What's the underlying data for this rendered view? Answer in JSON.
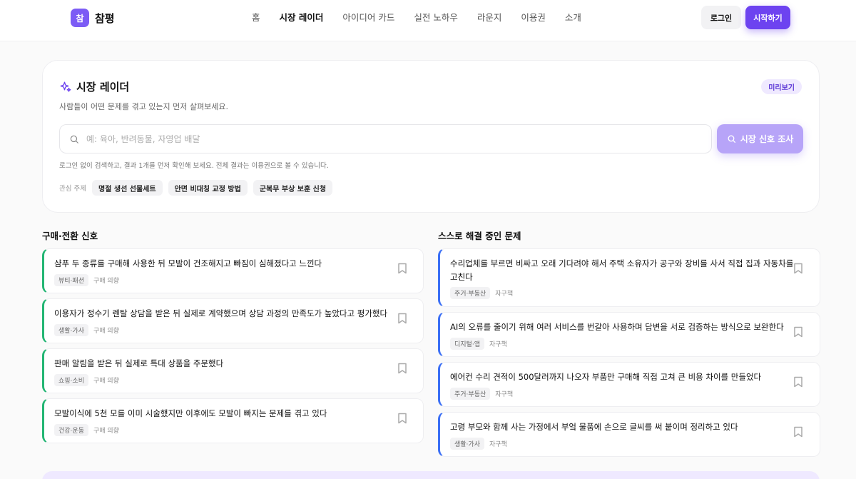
{
  "brand": {
    "mark": "참",
    "name": "참평"
  },
  "nav": [
    {
      "label": "홈"
    },
    {
      "label": "시장 레이더"
    },
    {
      "label": "아이디어 카드"
    },
    {
      "label": "실전 노하우"
    },
    {
      "label": "라운지"
    },
    {
      "label": "이용권"
    },
    {
      "label": "소개"
    }
  ],
  "auth": {
    "login": "로그인",
    "start": "시작하기"
  },
  "radar": {
    "title": "시장 레이더",
    "badge": "미리보기",
    "subtitle": "사람들이 어떤 문제를 겪고 있는지 먼저 살펴보세요.",
    "search_placeholder": "예: 육아, 반려동물, 자영업 배달",
    "search_value": "",
    "scan_button": "시장 신호 조사",
    "note": "로그인 없이 검색하고, 결과 1개를 먼저 확인해 보세요. 전체 결과는 이용권으로 볼 수 있습니다.",
    "topics_label": "관심 주제",
    "topics": [
      "명절 생선 선물세트",
      "안면 비대칭 교정 방법",
      "군복무 부상 보훈 신청"
    ]
  },
  "purchase": {
    "title": "구매·전환 신호",
    "items": [
      {
        "text": "샴푸 두 종류를 구매해 사용한 뒤 모발이 건조해지고 빠짐이 심해졌다고 느낀다",
        "category": "뷰티·패션",
        "signal": "구매 의향"
      },
      {
        "text": "이용자가 정수기 렌탈 상담을 받은 뒤 실제로 계약했으며 상담 과정의 만족도가 높았다고 평가했다",
        "category": "생활·가사",
        "signal": "구매 의향"
      },
      {
        "text": "판매 알림을 받은 뒤 실제로 특대 상품을 주문했다",
        "category": "쇼핑·소비",
        "signal": "구매 의향"
      },
      {
        "text": "모발이식에 5천 모를 이미 시술했지만 이후에도 모발이 빠지는 문제를 겪고 있다",
        "category": "건강·운동",
        "signal": "구매 의향"
      }
    ]
  },
  "selfsolve": {
    "title": "스스로 해결 중인 문제",
    "items": [
      {
        "text1": "수리업체를 부르면 비싸고 오래 기다려야 해서 주택 소유자가 공구와 장비를 사서 직접 집과 자동차를",
        "text2": "고친다",
        "category": "주거·부동산",
        "signal": "자구책"
      },
      {
        "text1": "AI의 오류를 줄이기 위해 여러 서비스를 번갈아 사용하며 답변을 서로 검증하는 방식으로 보완한다",
        "text2": "",
        "category": "디지털·앱",
        "signal": "자구책"
      },
      {
        "text1": "에어컨 수리 견적이 500달러까지 나오자 부품만 구매해 직접 고쳐 큰 비용 차이를 만들었다",
        "text2": "",
        "category": "주거·부동산",
        "signal": "자구책"
      },
      {
        "text1": "고령 부모와 함께 사는 가정에서 부엌 물품에 손으로 글씨를 써 붙이며 정리하고 있다",
        "text2": "",
        "category": "생활·가사",
        "signal": "자구책"
      }
    ]
  },
  "colors": {
    "accent": "#6d43f0",
    "green_rail": "#22b573",
    "blue_rail": "#3b6ff5"
  },
  "icons": [
    "sparkle-icon",
    "search-icon",
    "bookmark-icon"
  ]
}
